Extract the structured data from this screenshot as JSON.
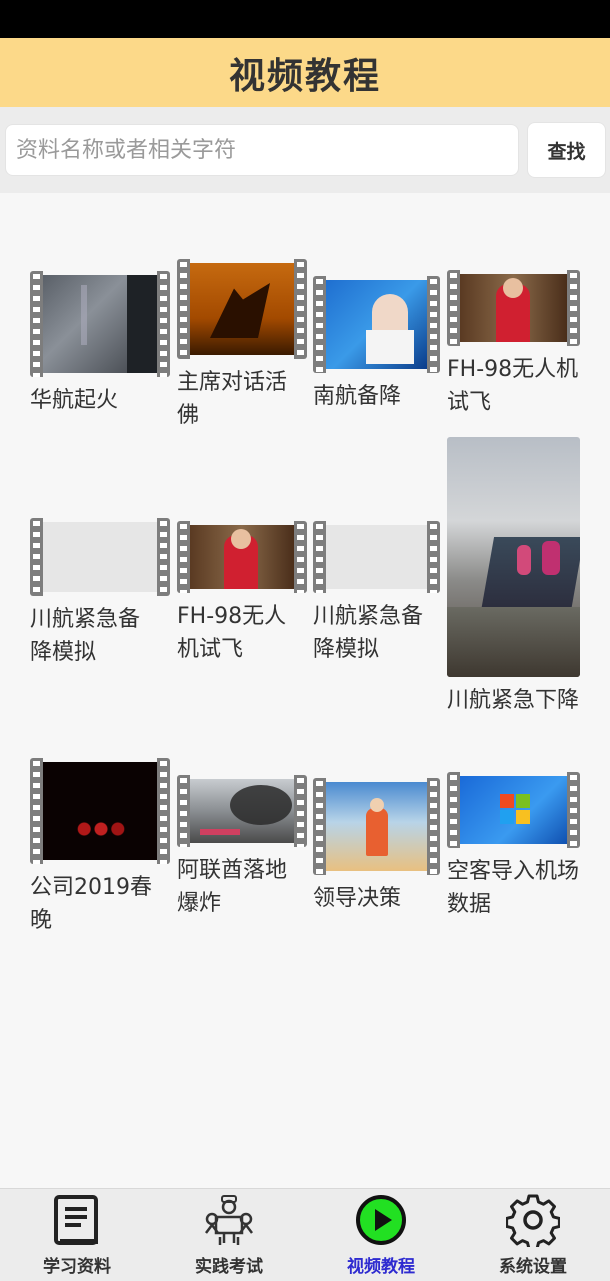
{
  "header": {
    "title": "视频教程"
  },
  "search": {
    "placeholder": "资料名称或者相关字符",
    "value": "",
    "button_label": "查找"
  },
  "videos": [
    {
      "caption": "华航起火"
    },
    {
      "caption": "主席对话活佛"
    },
    {
      "caption": "南航备降"
    },
    {
      "caption": "FH-98无人机试飞"
    },
    {
      "caption": "川航紧急备降模拟"
    },
    {
      "caption": "FH-98无人机试飞"
    },
    {
      "caption": "川航紧急备降模拟"
    },
    {
      "caption": "川航紧急下降"
    },
    {
      "caption": "公司2019春晚"
    },
    {
      "caption": "阿联酋落地爆炸"
    },
    {
      "caption": "领导决策"
    },
    {
      "caption": "空客导入机场数据"
    }
  ],
  "tabs": [
    {
      "label": "学习资料",
      "icon": "book-icon"
    },
    {
      "label": "实践考试",
      "icon": "exam-icon"
    },
    {
      "label": "视频教程",
      "icon": "play-icon",
      "active": true
    },
    {
      "label": "系统设置",
      "icon": "gear-icon"
    }
  ],
  "colors": {
    "header_bg": "#fcd989",
    "active_tab": "#2e2bd0",
    "play_green": "#22e022"
  }
}
